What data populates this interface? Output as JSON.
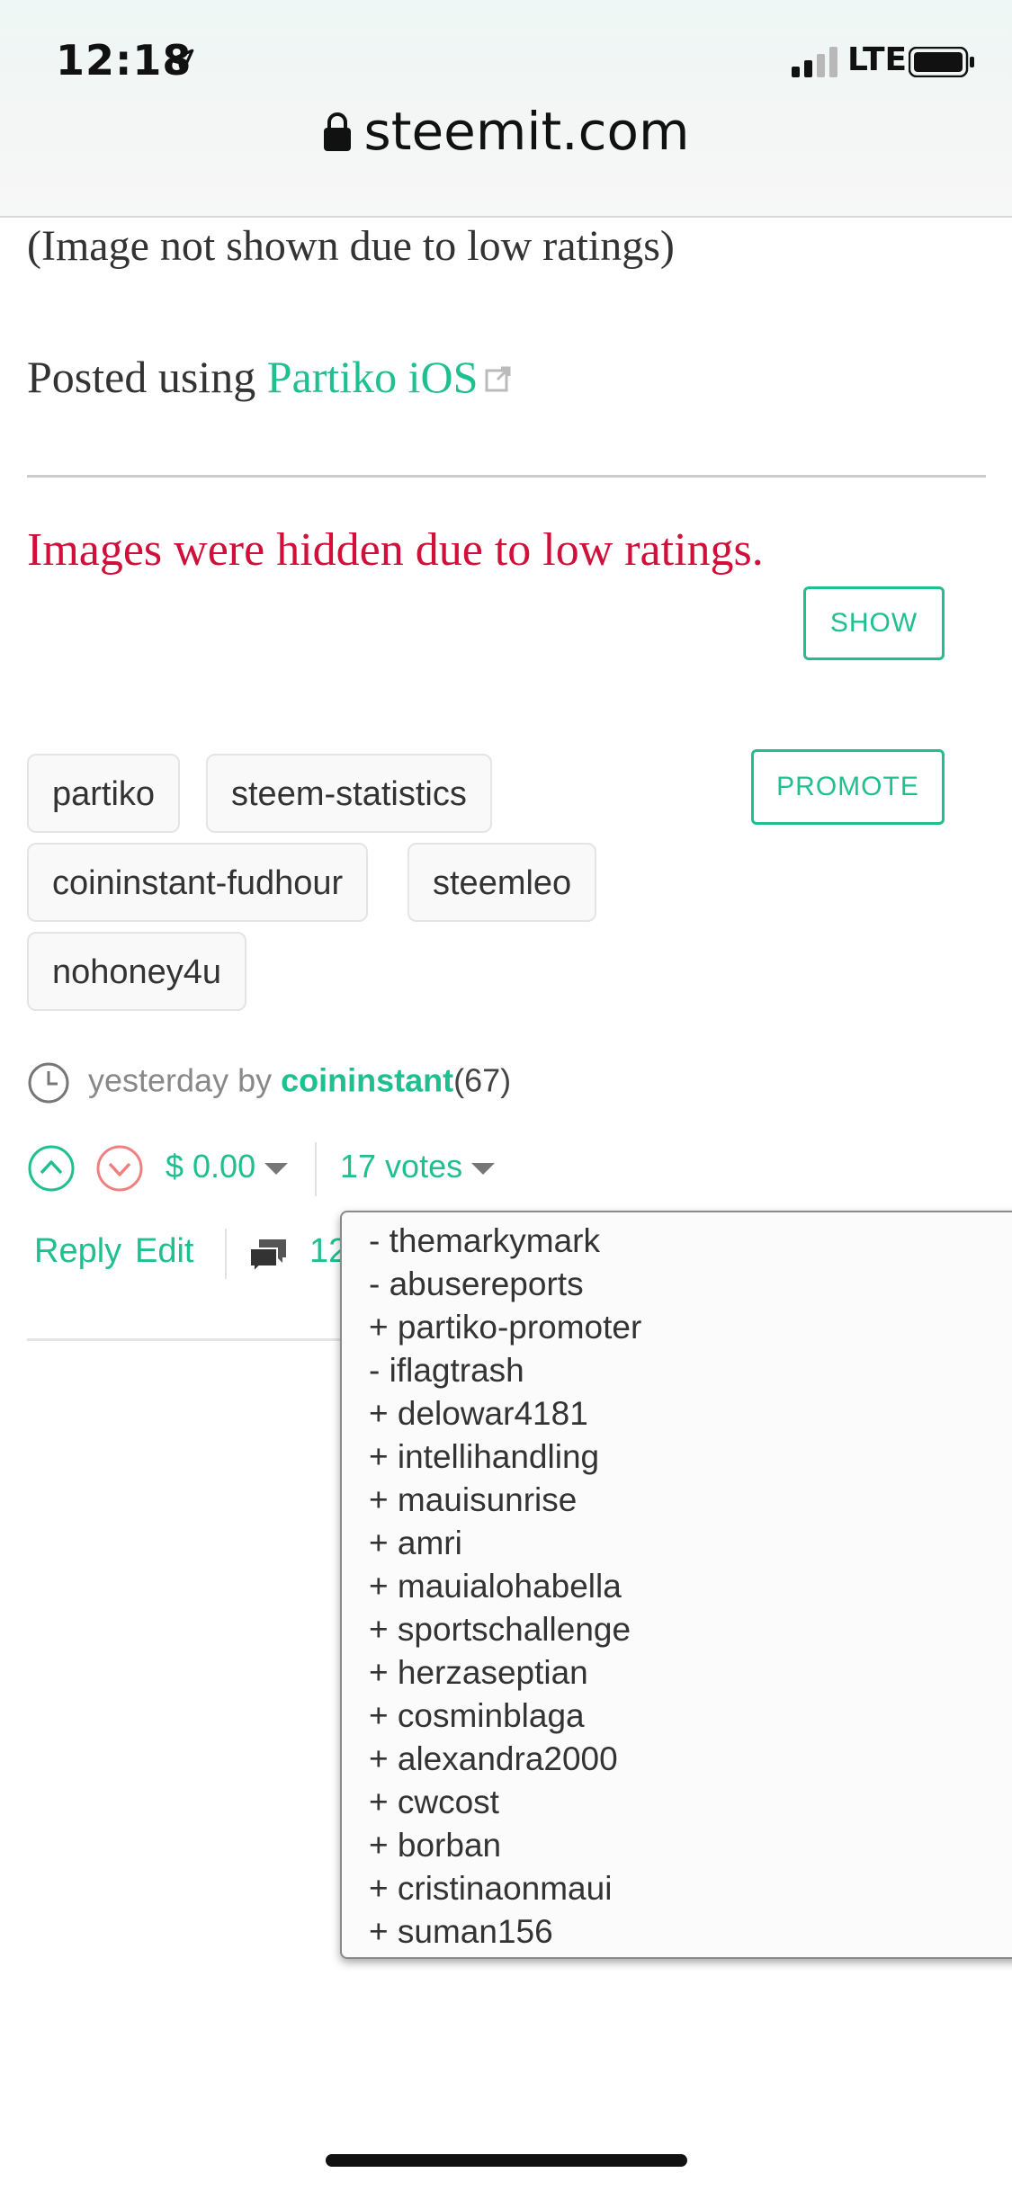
{
  "status_bar": {
    "time": "12:18",
    "carrier": "LTE",
    "icons": [
      "location-arrow-icon",
      "signal-icon",
      "battery-icon"
    ]
  },
  "browser": {
    "url": "steemit.com",
    "icons": [
      "lock-icon"
    ]
  },
  "post": {
    "image_hidden_text": "(Image not shown due to low ratings)",
    "posted_prefix": "Posted using ",
    "posted_link": "Partiko iOS",
    "warning": "Images were hidden due to low ratings.",
    "show_button": "SHOW",
    "promote_button": "PROMOTE",
    "tags": [
      "partiko",
      "steem-statistics",
      "coininstant-fudhour",
      "steemleo",
      "nohoney4u"
    ]
  },
  "meta": {
    "time": "yesterday",
    "by": " by ",
    "author": "coininstant",
    "reputation": "(67)"
  },
  "actions": {
    "payout": "$ 0.00",
    "votes": "17 votes",
    "reply": "Reply",
    "edit": "Edit",
    "comments_count": "12"
  },
  "voters": [
    "- themarkymark",
    "- abusereports",
    "+ partiko-promoter",
    "- iflagtrash",
    "+ delowar4181",
    "+ intellihandling",
    "+ mauisunrise",
    "+ amri",
    "+ mauialohabella",
    "+ sportschallenge",
    "+ herzaseptian",
    "+ cosminblaga",
    "+ alexandra2000",
    "+ cwcost",
    "+ borban",
    "+ cristinaonmaui",
    "+ suman156"
  ],
  "colors": {
    "accent": "#1fbf8f",
    "warning": "#d0103a",
    "downvote": "#f08080"
  }
}
